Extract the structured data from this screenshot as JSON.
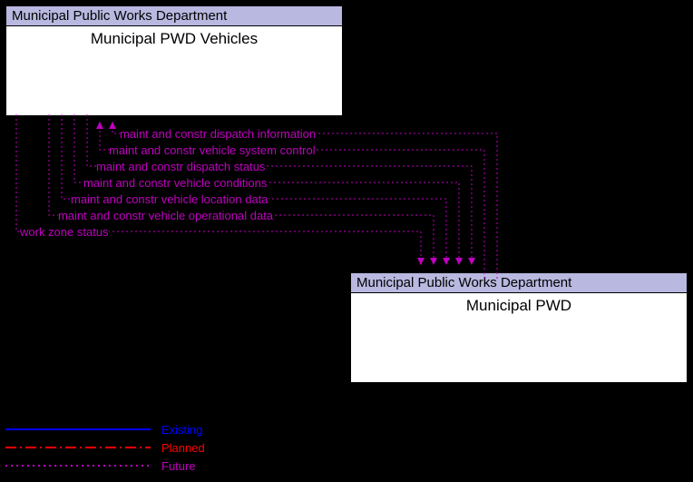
{
  "nodes": {
    "top": {
      "header": "Municipal Public Works Department",
      "title": "Municipal PWD Vehicles"
    },
    "bottom": {
      "header": "Municipal Public Works Department",
      "title": "Municipal PWD"
    }
  },
  "flows": [
    {
      "label": "maint and constr dispatch information",
      "dir": "up"
    },
    {
      "label": "maint and constr vehicle system control",
      "dir": "up"
    },
    {
      "label": "maint and constr dispatch status",
      "dir": "down"
    },
    {
      "label": "maint and constr vehicle conditions",
      "dir": "down"
    },
    {
      "label": "maint and constr vehicle location data",
      "dir": "down"
    },
    {
      "label": "maint and constr vehicle operational data",
      "dir": "down"
    },
    {
      "label": "work zone status",
      "dir": "down"
    }
  ],
  "legend": {
    "existing": {
      "label": "Existing",
      "color": "#0000ff"
    },
    "planned": {
      "label": "Planned",
      "color": "#ff0000"
    },
    "future": {
      "label": "Future",
      "color": "#c000c0"
    }
  }
}
